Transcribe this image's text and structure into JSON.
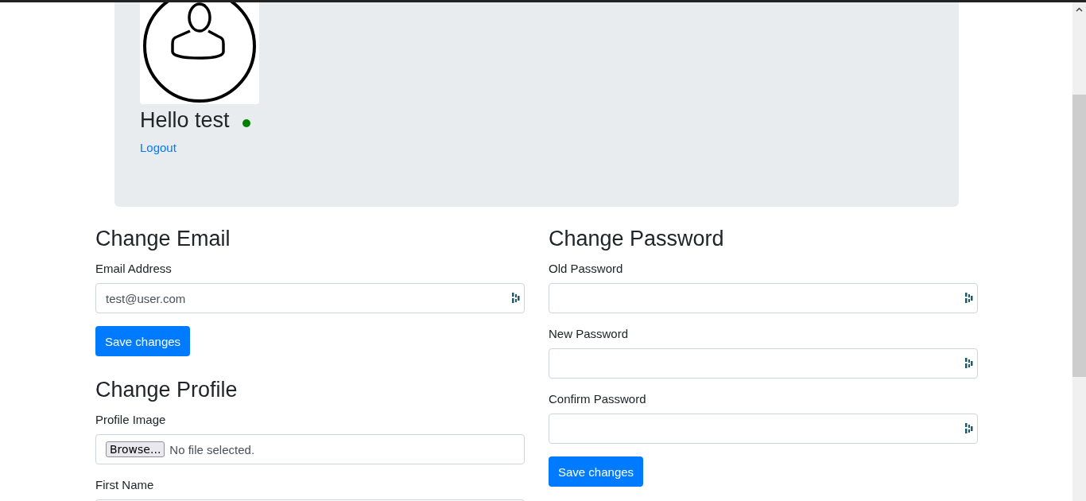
{
  "user": {
    "greeting": "Hello test",
    "online": true,
    "logout": "Logout"
  },
  "email_form": {
    "title": "Change Email",
    "fields": [
      {
        "label": "Email Address",
        "value": "test@user.com"
      }
    ],
    "button": "Save changes"
  },
  "profile_form": {
    "title": "Change Profile",
    "file": {
      "label": "Profile Image",
      "browse": "Browse...",
      "status": "No file selected."
    },
    "fields": [
      {
        "label": "First Name"
      }
    ]
  },
  "password_form": {
    "title": "Change Password",
    "fields": [
      {
        "label": "Old Password"
      },
      {
        "label": "New Password"
      },
      {
        "label": "Confirm Password"
      }
    ],
    "button": "Save changes"
  }
}
